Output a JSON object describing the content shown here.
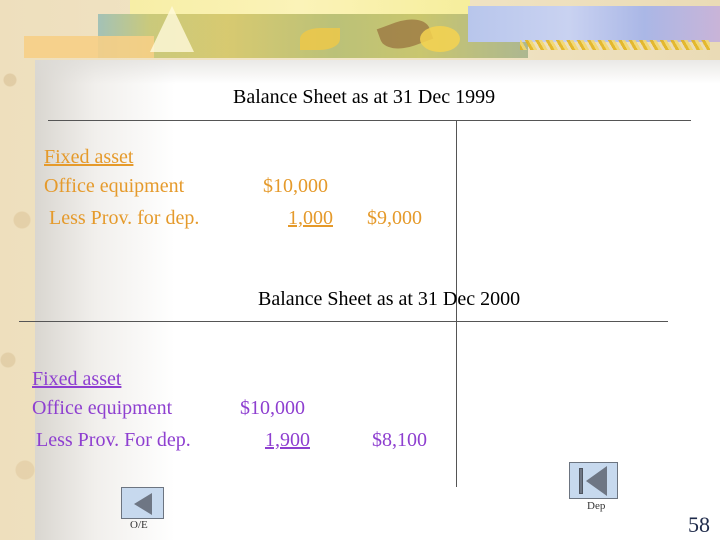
{
  "slide": {
    "page_number": "58",
    "colors": {
      "section1_text": "#e59a2b",
      "section2_text": "#8e3fd0",
      "title_text": "#000000",
      "nav_button_fill": "#c7d9ee",
      "nav_button_icon": "#6e7684"
    }
  },
  "sheet1999": {
    "title": "Balance Sheet as at 31 Dec 1999",
    "heading": "Fixed asset",
    "rows": [
      {
        "label": "Office equipment",
        "amount": "$10,000",
        "net": ""
      },
      {
        "label": "Less Prov. for dep.",
        "amount": "1,000",
        "net": "$9,000"
      }
    ]
  },
  "sheet2000": {
    "title": "Balance Sheet as at 31 Dec 2000",
    "heading": "Fixed asset",
    "rows": [
      {
        "label": "Office equipment",
        "amount": "$10,000",
        "net": ""
      },
      {
        "label": "Less Prov. For dep.",
        "amount": "1,900",
        "net": "$8,100"
      }
    ]
  },
  "navigation": {
    "back_button": {
      "icon": "triangle-left-icon",
      "label": "O/E"
    },
    "first_button": {
      "icon": "skip-to-start-icon",
      "label": "Dep"
    }
  }
}
